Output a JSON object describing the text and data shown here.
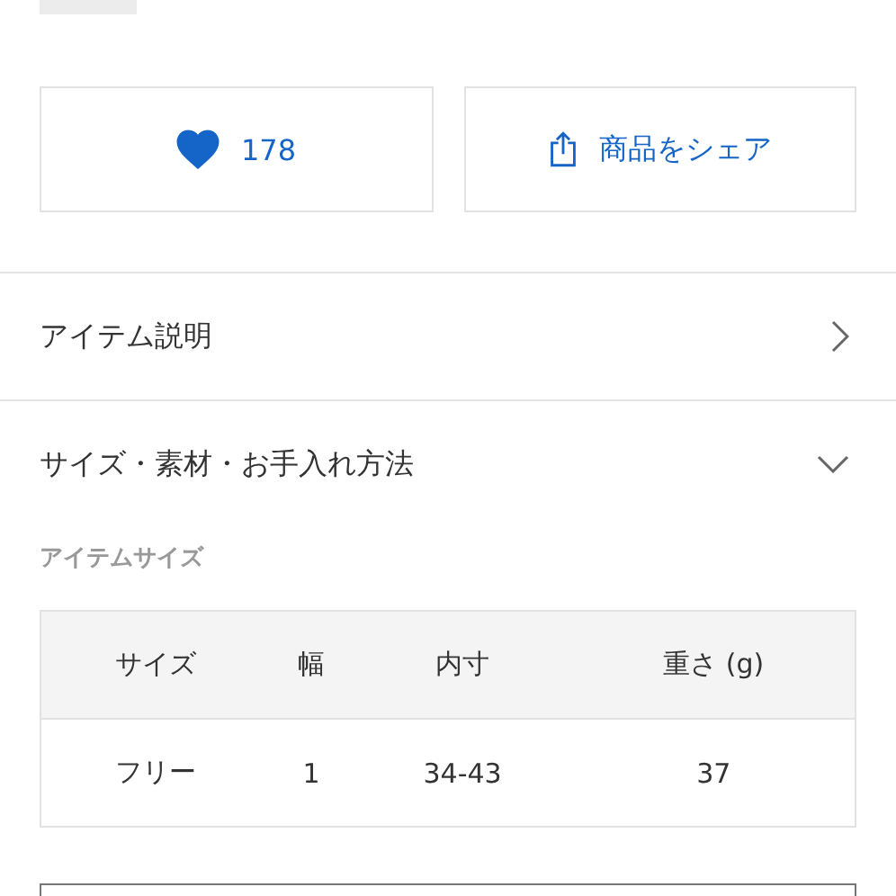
{
  "actions": {
    "like": {
      "count": "178",
      "liked": true
    },
    "share": {
      "label": "商品をシェア"
    }
  },
  "sections": [
    {
      "title": "アイテム説明",
      "expanded": false
    },
    {
      "title": "サイズ・素材・お手入れ方法",
      "expanded": true
    }
  ],
  "size_table": {
    "caption": "アイテムサイズ",
    "columns": [
      "サイズ",
      "幅",
      "内寸",
      "重さ (g)"
    ],
    "rows": [
      [
        "フリー",
        "1",
        "34-43",
        "37"
      ]
    ]
  }
}
